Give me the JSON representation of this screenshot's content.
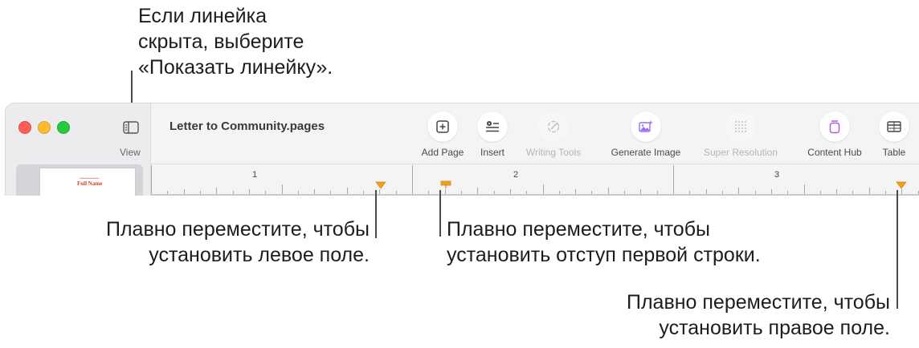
{
  "callouts": {
    "top": [
      "Если линейка",
      "скрыта, выберите",
      "«Показать линейку»."
    ],
    "left_margin": [
      "Плавно переместите, чтобы",
      "установить левое поле."
    ],
    "first_indent": [
      "Плавно переместите, чтобы",
      "установить отступ первой строки."
    ],
    "right_margin": [
      "Плавно переместите, чтобы",
      "установить правое поле."
    ]
  },
  "window": {
    "title": "Letter to Community.pages",
    "view_label": "View",
    "thumbnail_name": "Full Name",
    "toolbar": [
      {
        "label": "Add Page",
        "icon": "add-page-icon",
        "enabled": true
      },
      {
        "label": "Insert",
        "icon": "insert-icon",
        "enabled": true
      },
      {
        "label": "Writing Tools",
        "icon": "writing-tools-icon",
        "enabled": false
      },
      {
        "label": "Generate Image",
        "icon": "generate-image-icon",
        "enabled": true
      },
      {
        "label": "Super Resolution",
        "icon": "super-resolution-icon",
        "enabled": false
      },
      {
        "label": "Content Hub",
        "icon": "content-hub-icon",
        "enabled": true
      },
      {
        "label": "Table",
        "icon": "table-icon",
        "enabled": true
      }
    ]
  },
  "ruler": {
    "numbers": [
      "1",
      "2",
      "3"
    ],
    "marker_color": "#f0a020"
  },
  "colors": {
    "close": "#ff5f57",
    "minimize": "#febc2e",
    "zoom": "#28c840",
    "content_hub_accent": "#b05ad8",
    "generate_image_accent": "#9b6cf0"
  }
}
